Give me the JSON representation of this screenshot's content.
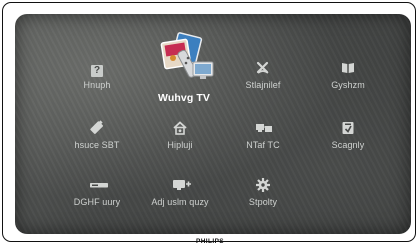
{
  "brand": "PHILIPS",
  "menu": {
    "items": [
      {
        "label": "Hnuph",
        "icon": "help-icon"
      },
      {
        "label": "Wuhvg TV",
        "icon": "watch-tv-icon",
        "selected": true
      },
      {
        "label": "Stlajnilef",
        "icon": "satellite-icon"
      },
      {
        "label": "Gyshzm",
        "icon": "book-icon"
      },
      {
        "label": "hsuce SBT",
        "icon": "usb-icon"
      },
      {
        "label": "Hipluji",
        "icon": "home-network-icon"
      },
      {
        "label": "NTaf TC",
        "icon": "network-icon"
      },
      {
        "label": "Scagnly",
        "icon": "scenario-icon"
      },
      {
        "label": "DGHF uury",
        "icon": "recorder-icon"
      },
      {
        "label": "Adj uslm quzy",
        "icon": "add-device-icon"
      },
      {
        "label": "Stpolty",
        "icon": "settings-gear-icon"
      }
    ]
  }
}
